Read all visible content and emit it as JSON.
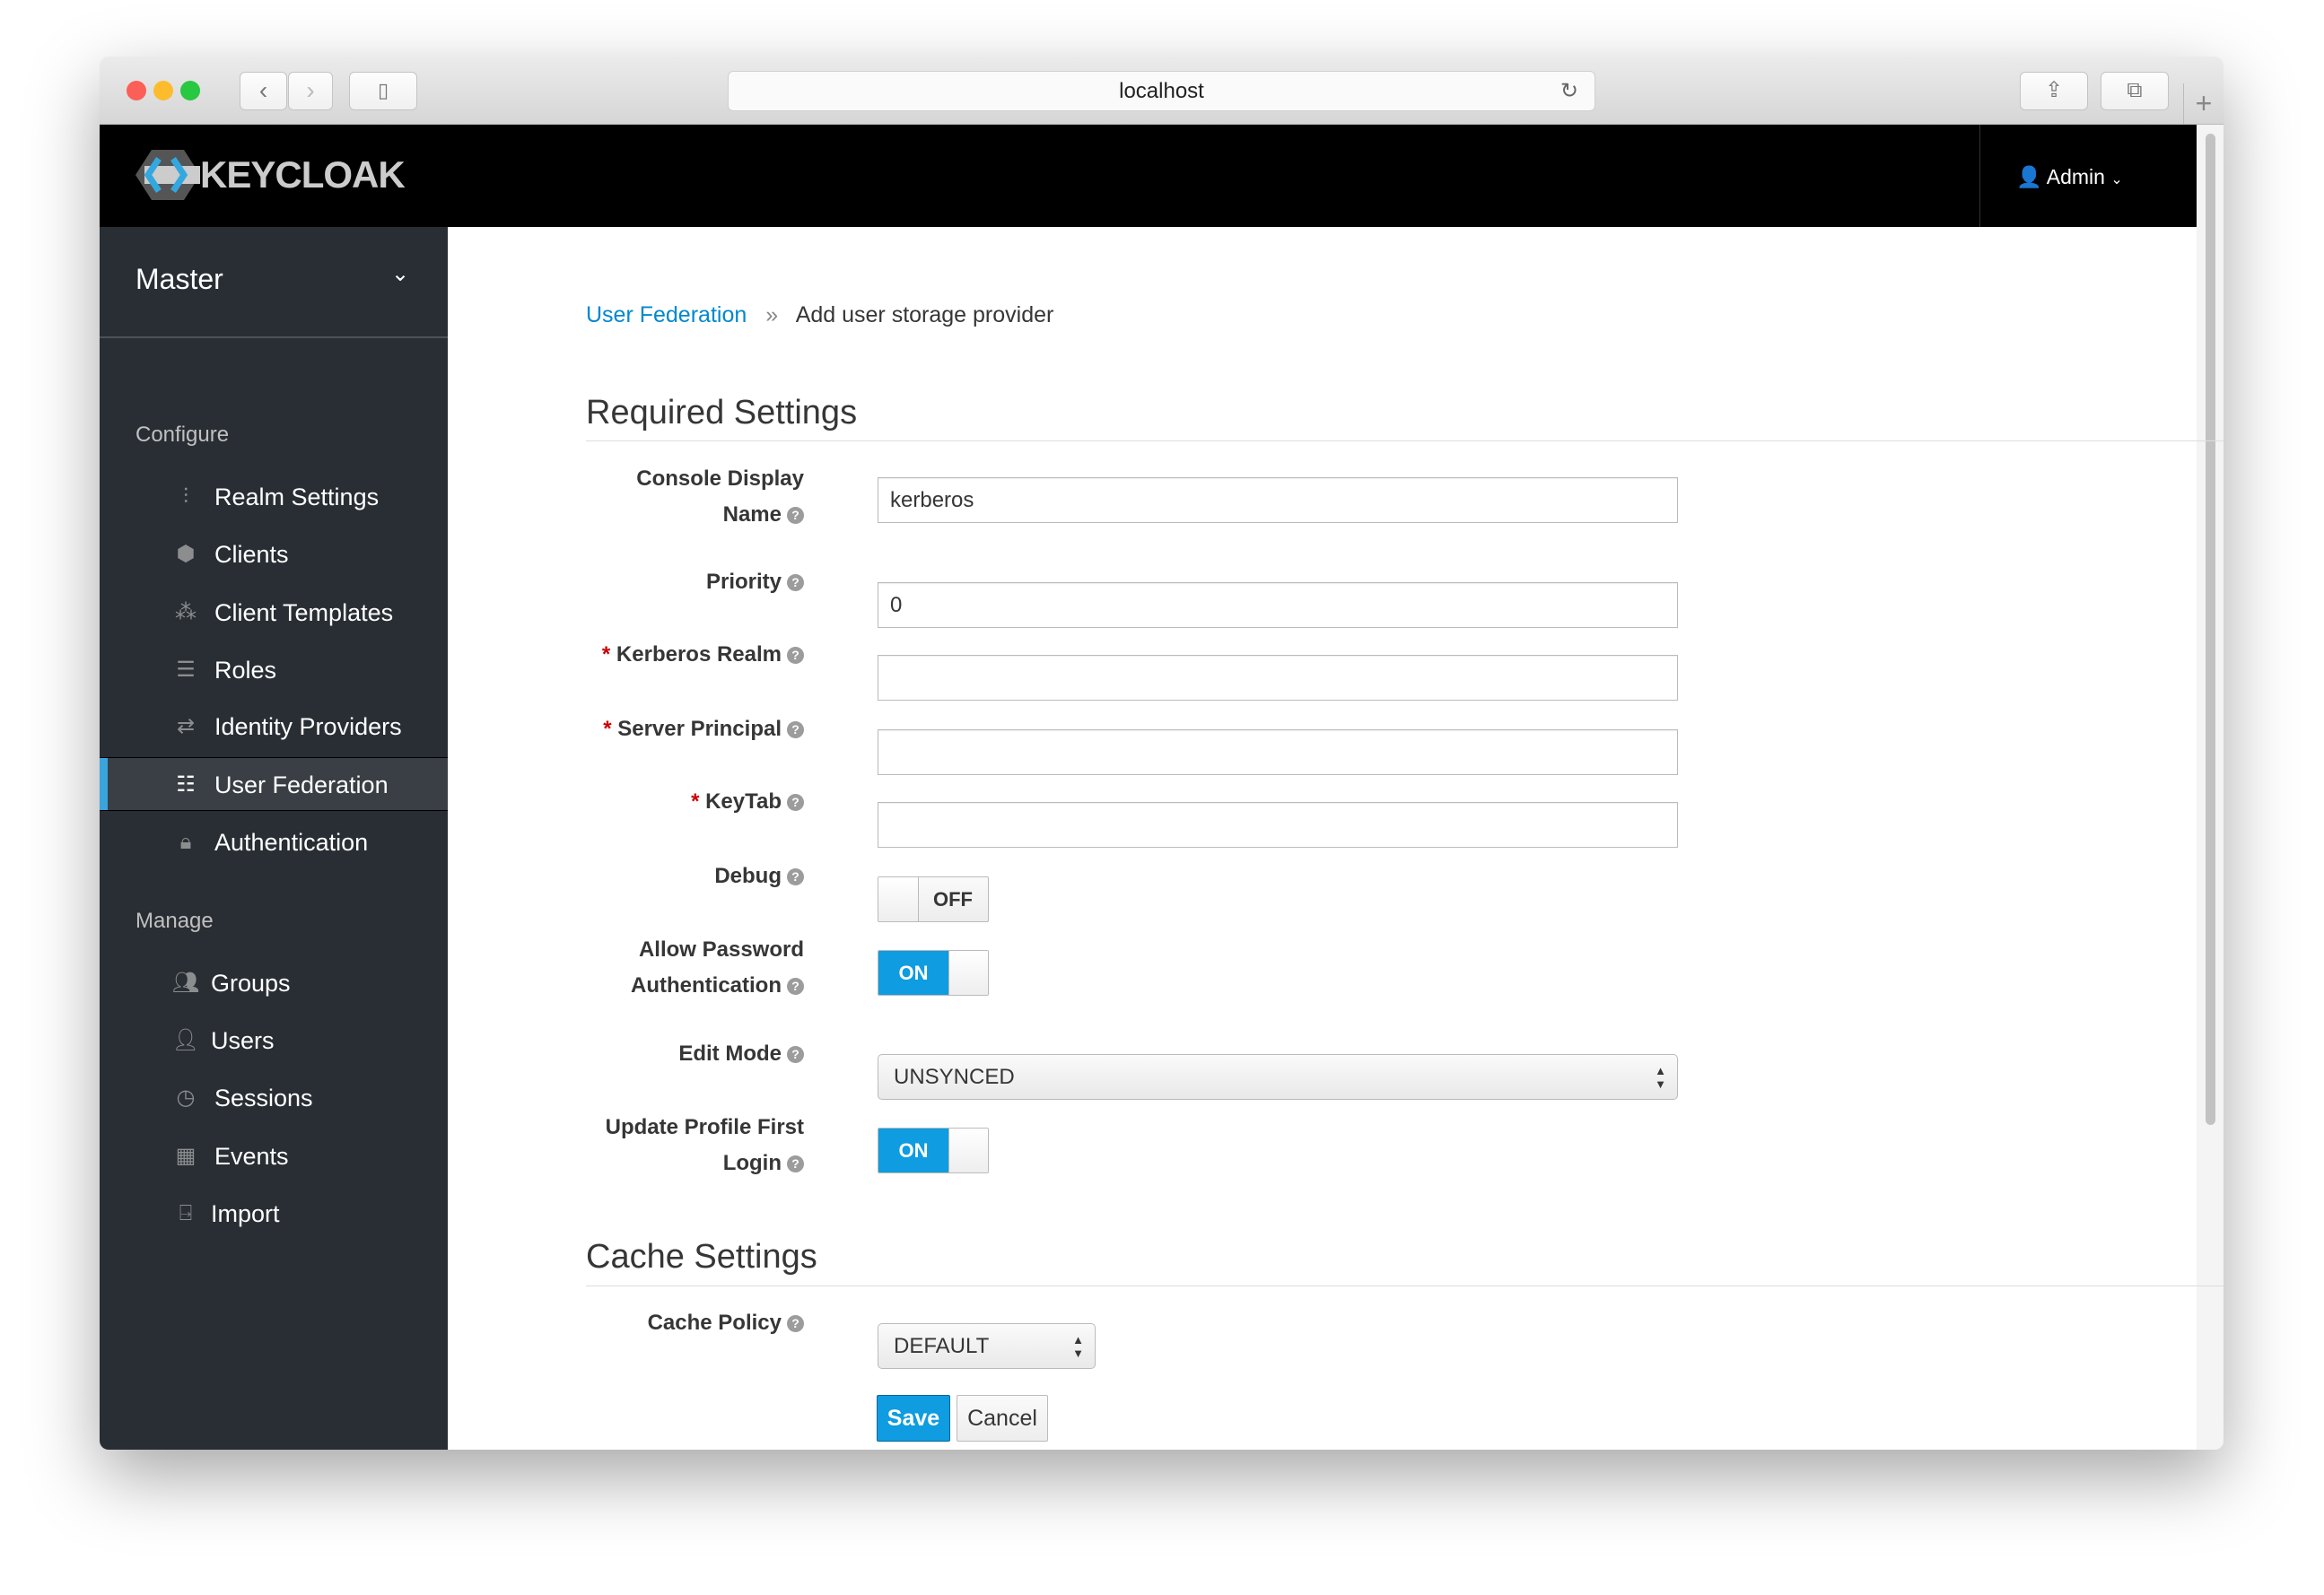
{
  "browser": {
    "url": "localhost"
  },
  "header": {
    "logo": "KEYCLOAK",
    "user": "Admin"
  },
  "sidebar": {
    "realm": "Master",
    "configure_label": "Configure",
    "manage_label": "Manage",
    "configure": [
      {
        "label": "Realm Settings",
        "icon": "sliders-icon"
      },
      {
        "label": "Clients",
        "icon": "cube-icon"
      },
      {
        "label": "Client Templates",
        "icon": "cubes-icon"
      },
      {
        "label": "Roles",
        "icon": "list-icon"
      },
      {
        "label": "Identity Providers",
        "icon": "exchange-icon"
      },
      {
        "label": "User Federation",
        "icon": "database-icon",
        "active": true
      },
      {
        "label": "Authentication",
        "icon": "lock-icon"
      }
    ],
    "manage": [
      {
        "label": "Groups",
        "icon": "users-icon"
      },
      {
        "label": "Users",
        "icon": "user-icon"
      },
      {
        "label": "Sessions",
        "icon": "clock-icon"
      },
      {
        "label": "Events",
        "icon": "calendar-icon"
      },
      {
        "label": "Import",
        "icon": "import-icon"
      }
    ]
  },
  "breadcrumb": {
    "parent": "User Federation",
    "sep": "»",
    "current": "Add user storage provider"
  },
  "required": {
    "title": "Required Settings",
    "console_display_name": {
      "label1": "Console Display",
      "label2": "Name",
      "value": "kerberos"
    },
    "priority": {
      "label": "Priority",
      "value": "0"
    },
    "kerberos_realm": {
      "label": "Kerberos Realm",
      "value": ""
    },
    "server_principal": {
      "label": "Server Principal",
      "value": ""
    },
    "keytab": {
      "label": "KeyTab",
      "value": ""
    },
    "debug": {
      "label": "Debug",
      "state": "OFF"
    },
    "allow_password": {
      "label1": "Allow Password",
      "label2": "Authentication",
      "state": "ON"
    },
    "edit_mode": {
      "label": "Edit Mode",
      "value": "UNSYNCED"
    },
    "update_profile": {
      "label1": "Update Profile First",
      "label2": "Login",
      "state": "ON"
    }
  },
  "cache": {
    "title": "Cache Settings",
    "policy": {
      "label": "Cache Policy",
      "value": "DEFAULT"
    }
  },
  "actions": {
    "save": "Save",
    "cancel": "Cancel"
  },
  "colors": {
    "accent": "#0f9ce0",
    "link": "#0088ce",
    "sidebar": "#292e34",
    "header": "#000000"
  }
}
